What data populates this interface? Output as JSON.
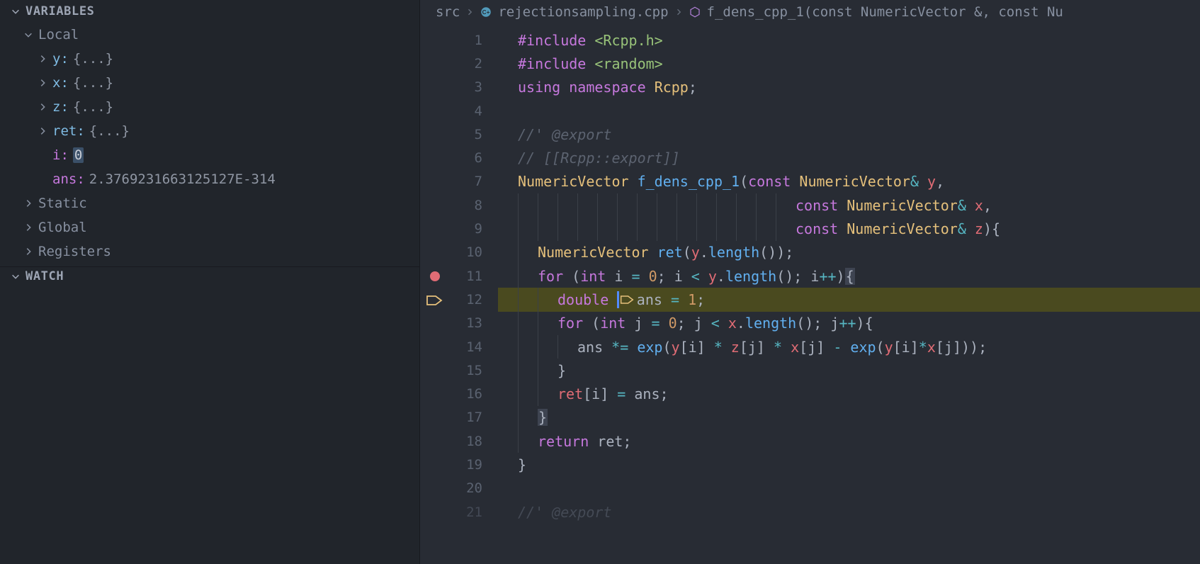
{
  "sidebar": {
    "sections": {
      "variables": "VARIABLES",
      "watch": "WATCH"
    },
    "scopes": {
      "local": "Local",
      "static": "Static",
      "global": "Global",
      "registers": "Registers"
    },
    "locals": [
      {
        "name": "y",
        "value": "{...}",
        "expandable": true
      },
      {
        "name": "x",
        "value": "{...}",
        "expandable": true
      },
      {
        "name": "z",
        "value": "{...}",
        "expandable": true
      },
      {
        "name": "ret",
        "value": "{...}",
        "expandable": true
      },
      {
        "name": "i",
        "value": "0",
        "expandable": false,
        "highlighted": true
      },
      {
        "name": "ans",
        "value": "2.3769231663125127E-314",
        "expandable": false
      }
    ]
  },
  "breadcrumbs": {
    "folder": "src",
    "file": "rejectionsampling.cpp",
    "symbol": "f_dens_cpp_1(const NumericVector &, const Nu"
  },
  "editor": {
    "breakpoint_line": 11,
    "current_line": 12,
    "lines": [
      {
        "n": 1,
        "tokens": [
          [
            "pre",
            "#include "
          ],
          [
            "str",
            "<Rcpp.h>"
          ]
        ]
      },
      {
        "n": 2,
        "tokens": [
          [
            "pre",
            "#include "
          ],
          [
            "str",
            "<random>"
          ]
        ]
      },
      {
        "n": 3,
        "tokens": [
          [
            "kw",
            "using"
          ],
          [
            "plain",
            " "
          ],
          [
            "kw",
            "namespace"
          ],
          [
            "plain",
            " "
          ],
          [
            "type",
            "Rcpp"
          ],
          [
            "plain",
            ";"
          ]
        ]
      },
      {
        "n": 4,
        "tokens": []
      },
      {
        "n": 5,
        "tokens": [
          [
            "cmt",
            "//' @export"
          ]
        ]
      },
      {
        "n": 6,
        "tokens": [
          [
            "cmt",
            "// [[Rcpp::export]]"
          ]
        ]
      },
      {
        "n": 7,
        "tokens": [
          [
            "type",
            "NumericVector"
          ],
          [
            "plain",
            " "
          ],
          [
            "fn",
            "f_dens_cpp_1"
          ],
          [
            "plain",
            "("
          ],
          [
            "kw",
            "const"
          ],
          [
            "plain",
            " "
          ],
          [
            "type",
            "NumericVector"
          ],
          [
            "op",
            "&"
          ],
          [
            "plain",
            " "
          ],
          [
            "id",
            "y"
          ],
          [
            "plain",
            ","
          ]
        ]
      },
      {
        "n": 8,
        "tokens": [
          [
            "kw",
            "const"
          ],
          [
            "plain",
            " "
          ],
          [
            "type",
            "NumericVector"
          ],
          [
            "op",
            "&"
          ],
          [
            "plain",
            " "
          ],
          [
            "id",
            "x"
          ],
          [
            "plain",
            ","
          ]
        ],
        "align": 14
      },
      {
        "n": 9,
        "tokens": [
          [
            "kw",
            "const"
          ],
          [
            "plain",
            " "
          ],
          [
            "type",
            "NumericVector"
          ],
          [
            "op",
            "&"
          ],
          [
            "plain",
            " "
          ],
          [
            "id",
            "z"
          ],
          [
            "plain",
            "){"
          ]
        ],
        "align": 14
      },
      {
        "n": 10,
        "indent": 1,
        "tokens": [
          [
            "type",
            "NumericVector"
          ],
          [
            "plain",
            " "
          ],
          [
            "fn",
            "ret"
          ],
          [
            "plain",
            "("
          ],
          [
            "id",
            "y"
          ],
          [
            "plain",
            "."
          ],
          [
            "fn",
            "length"
          ],
          [
            "plain",
            "());"
          ]
        ]
      },
      {
        "n": 11,
        "indent": 1,
        "tokens": [
          [
            "kw",
            "for"
          ],
          [
            "plain",
            " ("
          ],
          [
            "kw",
            "int"
          ],
          [
            "plain",
            " i "
          ],
          [
            "op",
            "="
          ],
          [
            "plain",
            " "
          ],
          [
            "num",
            "0"
          ],
          [
            "plain",
            "; i "
          ],
          [
            "op",
            "<"
          ],
          [
            "plain",
            " "
          ],
          [
            "id",
            "y"
          ],
          [
            "plain",
            "."
          ],
          [
            "fn",
            "length"
          ],
          [
            "plain",
            "(); i"
          ],
          [
            "op",
            "++"
          ],
          [
            "plain",
            ")"
          ],
          [
            "brace-hl",
            "{"
          ]
        ]
      },
      {
        "n": 12,
        "indent": 2,
        "current": true,
        "cursor_after_first": true,
        "tokens": [
          [
            "kw",
            "double"
          ],
          [
            "plain",
            " "
          ],
          [
            "plain",
            "ans "
          ],
          [
            "op",
            "="
          ],
          [
            "plain",
            " "
          ],
          [
            "num",
            "1"
          ],
          [
            "plain",
            ";"
          ]
        ]
      },
      {
        "n": 13,
        "indent": 2,
        "tokens": [
          [
            "kw",
            "for"
          ],
          [
            "plain",
            " ("
          ],
          [
            "kw",
            "int"
          ],
          [
            "plain",
            " j "
          ],
          [
            "op",
            "="
          ],
          [
            "plain",
            " "
          ],
          [
            "num",
            "0"
          ],
          [
            "plain",
            "; j "
          ],
          [
            "op",
            "<"
          ],
          [
            "plain",
            " "
          ],
          [
            "id",
            "x"
          ],
          [
            "plain",
            "."
          ],
          [
            "fn",
            "length"
          ],
          [
            "plain",
            "(); j"
          ],
          [
            "op",
            "++"
          ],
          [
            "plain",
            "){"
          ]
        ]
      },
      {
        "n": 14,
        "indent": 3,
        "tokens": [
          [
            "plain",
            "ans "
          ],
          [
            "op",
            "*="
          ],
          [
            "plain",
            " "
          ],
          [
            "fn",
            "exp"
          ],
          [
            "plain",
            "("
          ],
          [
            "id",
            "y"
          ],
          [
            "plain",
            "[i] "
          ],
          [
            "op",
            "*"
          ],
          [
            "plain",
            " "
          ],
          [
            "id",
            "z"
          ],
          [
            "plain",
            "[j] "
          ],
          [
            "op",
            "*"
          ],
          [
            "plain",
            " "
          ],
          [
            "id",
            "x"
          ],
          [
            "plain",
            "[j] "
          ],
          [
            "op",
            "-"
          ],
          [
            "plain",
            " "
          ],
          [
            "fn",
            "exp"
          ],
          [
            "plain",
            "("
          ],
          [
            "id",
            "y"
          ],
          [
            "plain",
            "[i]"
          ],
          [
            "op",
            "*"
          ],
          [
            "id",
            "x"
          ],
          [
            "plain",
            "[j]));"
          ]
        ]
      },
      {
        "n": 15,
        "indent": 2,
        "tokens": [
          [
            "plain",
            "}"
          ]
        ]
      },
      {
        "n": 16,
        "indent": 2,
        "tokens": [
          [
            "id",
            "ret"
          ],
          [
            "plain",
            "[i] "
          ],
          [
            "op",
            "="
          ],
          [
            "plain",
            " ans;"
          ]
        ]
      },
      {
        "n": 17,
        "indent": 1,
        "tokens": [
          [
            "brace-hl",
            "}"
          ]
        ]
      },
      {
        "n": 18,
        "indent": 1,
        "tokens": [
          [
            "kw",
            "return"
          ],
          [
            "plain",
            " ret;"
          ]
        ]
      },
      {
        "n": 19,
        "tokens": [
          [
            "plain",
            "}"
          ]
        ]
      },
      {
        "n": 20,
        "tokens": []
      },
      {
        "n": 21,
        "tokens": [
          [
            "cmt",
            "//' @export"
          ]
        ],
        "faded": true
      }
    ]
  }
}
